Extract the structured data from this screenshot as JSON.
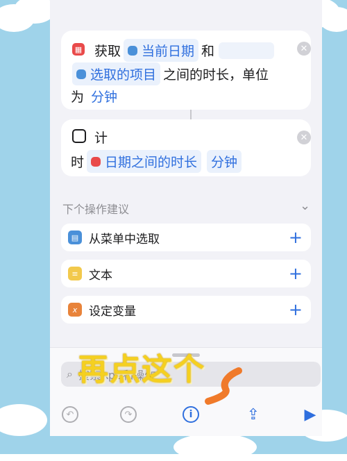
{
  "action_get": {
    "verb": "获取",
    "token1": "当前日期",
    "and": "和",
    "token2": "选取的项目",
    "rest": "之间的时长，单位",
    "unit_prefix": "为",
    "unit": "分钟"
  },
  "action_timer": {
    "verb_a": "计",
    "verb_b": "时",
    "token": "日期之间的时长",
    "unit": "分钟"
  },
  "suggestions": {
    "header": "下个操作建议",
    "items": [
      {
        "label": "从菜单中选取",
        "icon": "menu-icon",
        "color": "#4a90d9"
      },
      {
        "label": "文本",
        "icon": "text-icon",
        "color": "#f2c94c"
      },
      {
        "label": "设定变量",
        "icon": "variable-icon",
        "color": "#e8833a"
      }
    ]
  },
  "search": {
    "text": "搜索App和操作"
  },
  "overlay": {
    "caption": "再点这个"
  },
  "colors": {
    "accent": "#2f6fde",
    "caption": "#f5d020",
    "arrow": "#f07a2a",
    "frame": "#9fd3ea"
  }
}
